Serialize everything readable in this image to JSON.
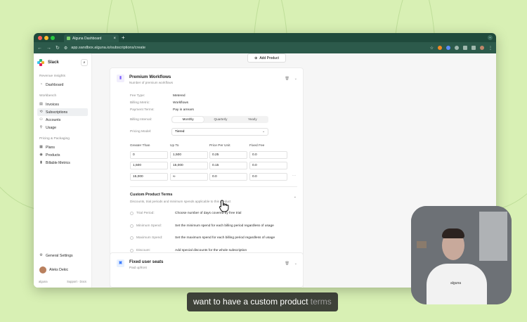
{
  "browser": {
    "tab_title": "Alguna Dashboard",
    "new_tab": "+",
    "url": "app.sandbox.alguna.io/subscriptions/create",
    "colors": {
      "frame": "#1f4a3c",
      "toolbar": "#2c5a4b"
    }
  },
  "sidebar": {
    "org_name": "Slack",
    "sections": [
      {
        "title": "Revenue Insights",
        "items": [
          {
            "label": "Dashboard",
            "icon": "chart-icon"
          }
        ]
      },
      {
        "title": "Workbench",
        "items": [
          {
            "label": "Invoices",
            "icon": "file-icon"
          },
          {
            "label": "Subscriptions",
            "icon": "refresh-icon",
            "active": true
          },
          {
            "label": "Accounts",
            "icon": "users-icon"
          },
          {
            "label": "Usage",
            "icon": "person-icon"
          }
        ]
      },
      {
        "title": "Pricing & Packaging",
        "items": [
          {
            "label": "Plans",
            "icon": "grid-icon"
          },
          {
            "label": "Products",
            "icon": "box-icon"
          },
          {
            "label": "Billable Metrics",
            "icon": "bars-icon"
          }
        ]
      }
    ],
    "settings_label": "General Settings",
    "user_name": "Aleks Dekic",
    "footer_brand": "alguna",
    "footer_links": "Support · Docs"
  },
  "main": {
    "add_product_label": "Add Product",
    "product": {
      "title": "Premium Workflows",
      "subtitle": "Number of premium workflows",
      "fields": [
        {
          "key": "Fee Type:",
          "value": "Metered"
        },
        {
          "key": "Billing Metric:",
          "value": "Workflows"
        },
        {
          "key": "Payment Terms:",
          "value": "Pay in arrears"
        }
      ],
      "billing_interval_label": "Billing Interval:",
      "billing_intervals": [
        "Monthly",
        "Quarterly",
        "Yearly"
      ],
      "selected_interval": "Monthly",
      "pricing_model_label": "Pricing Model:",
      "pricing_model": "Tiered",
      "tier_headers": [
        "Greater Than",
        "Up To",
        "Price Per Unit",
        "Fixed Fee"
      ],
      "tiers": [
        [
          "0",
          "1,500",
          "0.25",
          "0.0"
        ],
        [
          "1,500",
          "15,000",
          "0.15",
          "0.0"
        ],
        [
          "15,000",
          "∞",
          "0.0",
          "0.0"
        ]
      ],
      "row_menu": "···"
    },
    "custom_terms": {
      "title": "Custom Product Terms",
      "subtitle": "Discounts, trial periods and minimum spends applicable to this product",
      "terms": [
        {
          "key": "Trial Period:",
          "value": "Choose number of days covered by free trial"
        },
        {
          "key": "Minimum Spend:",
          "value": "Set the minimum spend for each billing period regardless of usage"
        },
        {
          "key": "Maximum Spend:",
          "value": "Set the maximum spend for each billing period regardless of usage"
        },
        {
          "key": "Discount:",
          "value": "Add special discounts for the whole subscription"
        }
      ]
    },
    "product2": {
      "title": "Fixed user seats",
      "subtitle": "Paid upfront"
    }
  },
  "webcam": {
    "shirt_logo": "alguna"
  },
  "caption": {
    "text": "want to have a custom product",
    "dim": "terms"
  }
}
